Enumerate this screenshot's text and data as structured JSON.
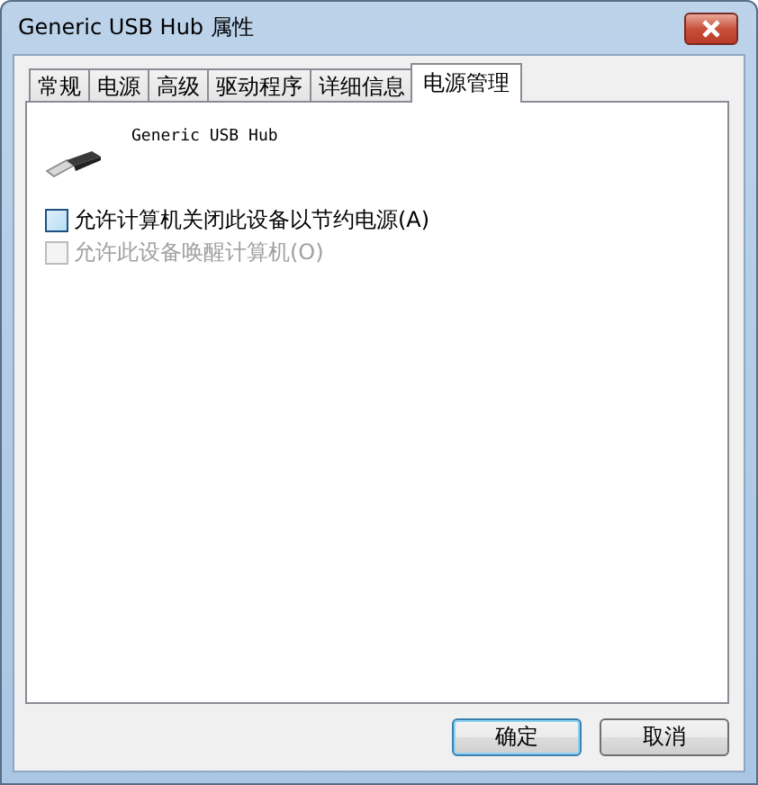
{
  "window": {
    "title": "Generic USB Hub 属性"
  },
  "tabs": [
    {
      "label": "常规",
      "selected": false
    },
    {
      "label": "电源",
      "selected": false
    },
    {
      "label": "高级",
      "selected": false
    },
    {
      "label": "驱动程序",
      "selected": false
    },
    {
      "label": "详细信息",
      "selected": false
    },
    {
      "label": "电源管理",
      "selected": true
    }
  ],
  "device": {
    "name": "Generic USB Hub"
  },
  "options": [
    {
      "label": "允许计算机关闭此设备以节约电源(A)",
      "checked": false,
      "disabled": false
    },
    {
      "label": "允许此设备唤醒计算机(O)",
      "checked": false,
      "disabled": true
    }
  ],
  "buttons": [
    {
      "label": "确定",
      "default": true
    },
    {
      "label": "取消",
      "default": false
    }
  ]
}
